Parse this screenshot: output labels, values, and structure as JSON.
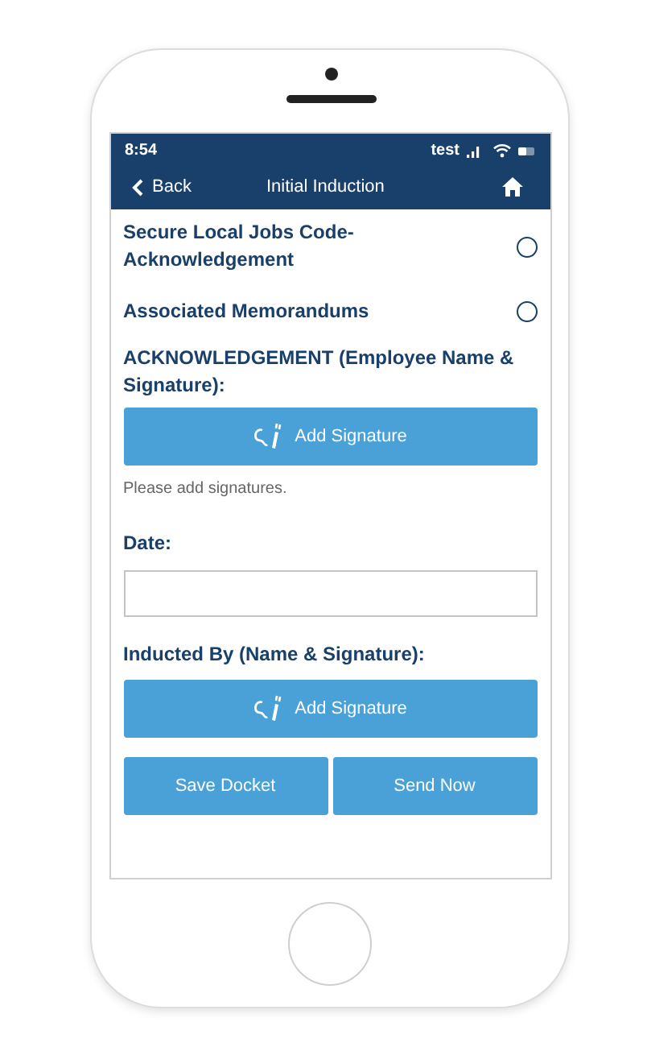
{
  "status_bar": {
    "time": "8:54",
    "carrier": "test"
  },
  "header": {
    "back": "Back",
    "title": "Initial Induction"
  },
  "checklist": [
    {
      "label": "Secure Local Jobs Code-Acknowledgement",
      "checked": false
    },
    {
      "label": "Associated Memorandums",
      "checked": false
    }
  ],
  "acknowledgement": {
    "label": "ACKNOWLEDGEMENT (Employee Name & Signature):",
    "button": "Add Signature",
    "hint": "Please add signatures."
  },
  "date": {
    "label": "Date:"
  },
  "inducted_by": {
    "label": "Inducted By (Name & Signature):",
    "button": "Add Signature"
  },
  "buttons": [
    "Save Docket",
    "Send Now"
  ]
}
